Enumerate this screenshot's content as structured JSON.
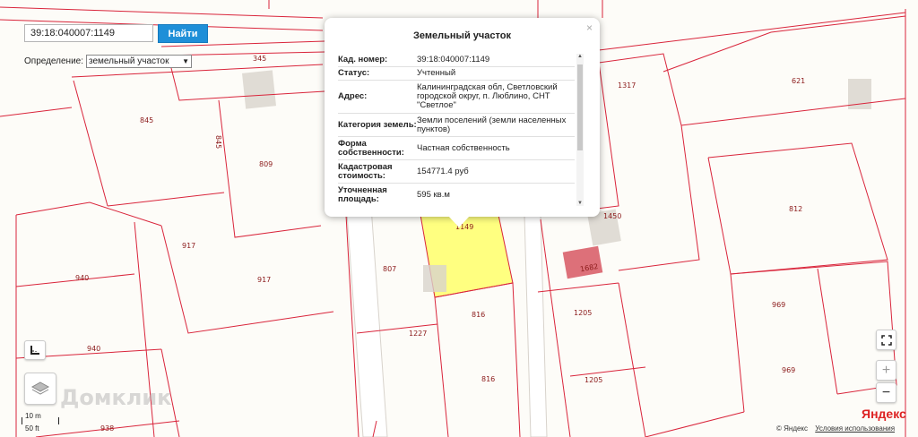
{
  "search": {
    "value": "39:18:040007:1149",
    "button_label": "Найти"
  },
  "definition": {
    "label": "Определение:",
    "selected": "земельный участок"
  },
  "balloon": {
    "title": "Земельный участок",
    "close_symbol": "×",
    "rows": [
      {
        "key": "Кад. номер:",
        "value": "39:18:040007:1149"
      },
      {
        "key": "Статус:",
        "value": "Учтенный"
      },
      {
        "key": "Адрес:",
        "value": "Калининградская обл, Светловский городской округ, п. Люблино, СНТ \"Светлое\""
      },
      {
        "key": "Категория земель:",
        "value": "Земли поселений (земли населенных пунктов)"
      },
      {
        "key": "Форма собственности:",
        "value": "Частная собственность"
      },
      {
        "key": "Кадастровая стоимость:",
        "value": "154771.4 руб"
      },
      {
        "key": "Уточненная площадь:",
        "value": "595 кв.м"
      }
    ]
  },
  "plots": {
    "p345": "345",
    "p845a": "845",
    "p845b": "845",
    "p809": "809",
    "p917a": "917",
    "p917b": "917",
    "p940a": "940",
    "p940b": "940",
    "p938": "938",
    "p807": "807",
    "p1149": "1149",
    "p1227": "1227",
    "p816a": "816",
    "p816b": "816",
    "p1317": "1317",
    "p621": "621",
    "p1450": "1450",
    "p1682": "1682",
    "p812": "812",
    "p1205a": "1205",
    "p1205b": "1205",
    "p969a": "969",
    "p969b": "969"
  },
  "colors": {
    "selected_fill": "#ffff80",
    "boundary": "#d9253b",
    "building": "#d8d3cc",
    "building_red": "#d9606a",
    "map_bg": "#fdfcf8",
    "road": "#ffffff"
  },
  "controls": {
    "fullscreen_icon": "fullscreen-icon",
    "zoom_in": "+",
    "zoom_out": "−",
    "ruler_icon": "ruler-icon",
    "layers_icon": "layers-icon"
  },
  "watermark": "Домклик",
  "scale": {
    "metric": "10 m",
    "imperial": "50 ft"
  },
  "attribution": {
    "copyright": "© Яндекс",
    "terms": "Условия использования",
    "logo": "Яндекс"
  }
}
